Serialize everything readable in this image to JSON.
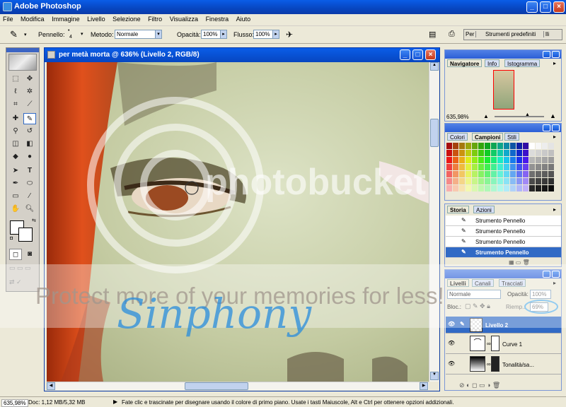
{
  "app": {
    "title": "Adobe Photoshop"
  },
  "menu": [
    "File",
    "Modifica",
    "Immagine",
    "Livello",
    "Selezione",
    "Filtro",
    "Visualizza",
    "Finestra",
    "Aiuto"
  ],
  "options_bar": {
    "brush_label": "Pennello:",
    "brush_size": "4",
    "mode_label": "Metodo:",
    "mode_value": "Normale",
    "opacity_label": "Opacità:",
    "opacity_value": "100%",
    "flow_label": "Flusso:",
    "flow_value": "100%",
    "presets_tab": "Per",
    "presets_label": "Strumenti predefiniti",
    "presets_tab2": "lli"
  },
  "document": {
    "title": "per metà morta @ 636% (Livello 2, RGB/8)"
  },
  "navigator": {
    "tabs": [
      "Navigatore",
      "Info",
      "Istogramma"
    ],
    "zoom": "635,98%"
  },
  "swatches": {
    "tabs": [
      "Colori",
      "Campioni",
      "Stili"
    ]
  },
  "history": {
    "tabs": [
      "Storia",
      "Azioni"
    ],
    "items": [
      "Strumento Pennello",
      "Strumento Pennello",
      "Strumento Pennello",
      "Strumento Pennello"
    ]
  },
  "layers": {
    "tabs": [
      "Livelli",
      "Canali",
      "Tracciati"
    ],
    "blend_mode": "Normale",
    "opacity_label": "Opacità:",
    "opacity_value": "100%",
    "lock_label": "Bloc.:",
    "fill_label": "Riemp.:",
    "fill_value": "69%",
    "items": [
      "Livello 2",
      "Curve 1",
      "Tonalità/sa..."
    ]
  },
  "status": {
    "zoom": "635,98%",
    "doc": "Doc: 1,12 MB/5,32 MB",
    "hint": "Fate clic e trascinate per disegnare usando il colore di primo piano.  Usate i tasti Maiuscole, Alt e Ctrl per ottenere opzioni addizionali."
  },
  "watermark": {
    "brand": "photobucket",
    "protect": "Protect more of your memories for less!",
    "signature": "Sinphony"
  }
}
